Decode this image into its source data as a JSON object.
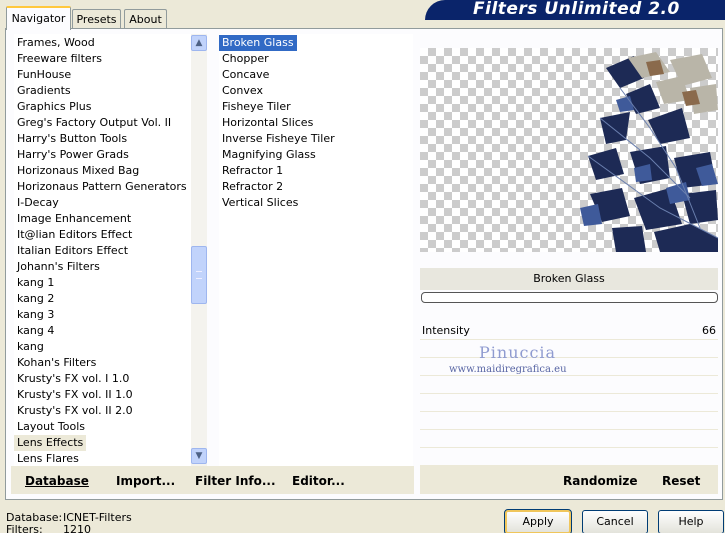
{
  "tabs": [
    "Navigator",
    "Presets",
    "About"
  ],
  "banner_title": "Filters Unlimited 2.0",
  "categories": [
    "Frames, Wood",
    "Freeware filters",
    "FunHouse",
    "Gradients",
    "Graphics Plus",
    "Greg's Factory Output Vol. II",
    "Harry's Button Tools",
    "Harry's Power Grads",
    "Horizonaus Mixed Bag",
    "Horizonaus Pattern Generators",
    "I-Decay",
    "Image Enhancement",
    "It@lian Editors Effect",
    "Italian Editors Effect",
    "Johann's Filters",
    "kang 1",
    "kang 2",
    "kang 3",
    "kang 4",
    "kang",
    "Kohan's Filters",
    "Krusty's FX vol. I 1.0",
    "Krusty's FX vol. II 1.0",
    "Krusty's FX vol. II 2.0",
    "Layout Tools",
    "Lens Effects",
    "Lens Flares"
  ],
  "selected_category": "Lens Effects",
  "filters": [
    "Broken Glass",
    "Chopper",
    "Concave",
    "Convex",
    "Fisheye Tiler",
    "Horizontal Slices",
    "Inverse Fisheye Tiler",
    "Magnifying Glass",
    "Refractor 1",
    "Refractor 2",
    "Vertical Slices"
  ],
  "selected_filter": "Broken Glass",
  "left_buttons": {
    "database": "Database",
    "import": "Import...",
    "filter_info": "Filter Info...",
    "editor": "Editor..."
  },
  "right_buttons": {
    "randomize": "Randomize",
    "reset": "Reset"
  },
  "preview_filter_name": "Broken Glass",
  "parameter": {
    "name": "Intensity",
    "value": "66"
  },
  "watermark": {
    "name": "Pinuccia",
    "url": "www.maidiregrafica.eu"
  },
  "status": {
    "database_label": "Database:",
    "database_value": "ICNET-Filters",
    "filters_label": "Filters:",
    "filters_value": "1210"
  },
  "dialog_buttons": {
    "apply": "Apply",
    "cancel": "Cancel",
    "help": "Help"
  }
}
